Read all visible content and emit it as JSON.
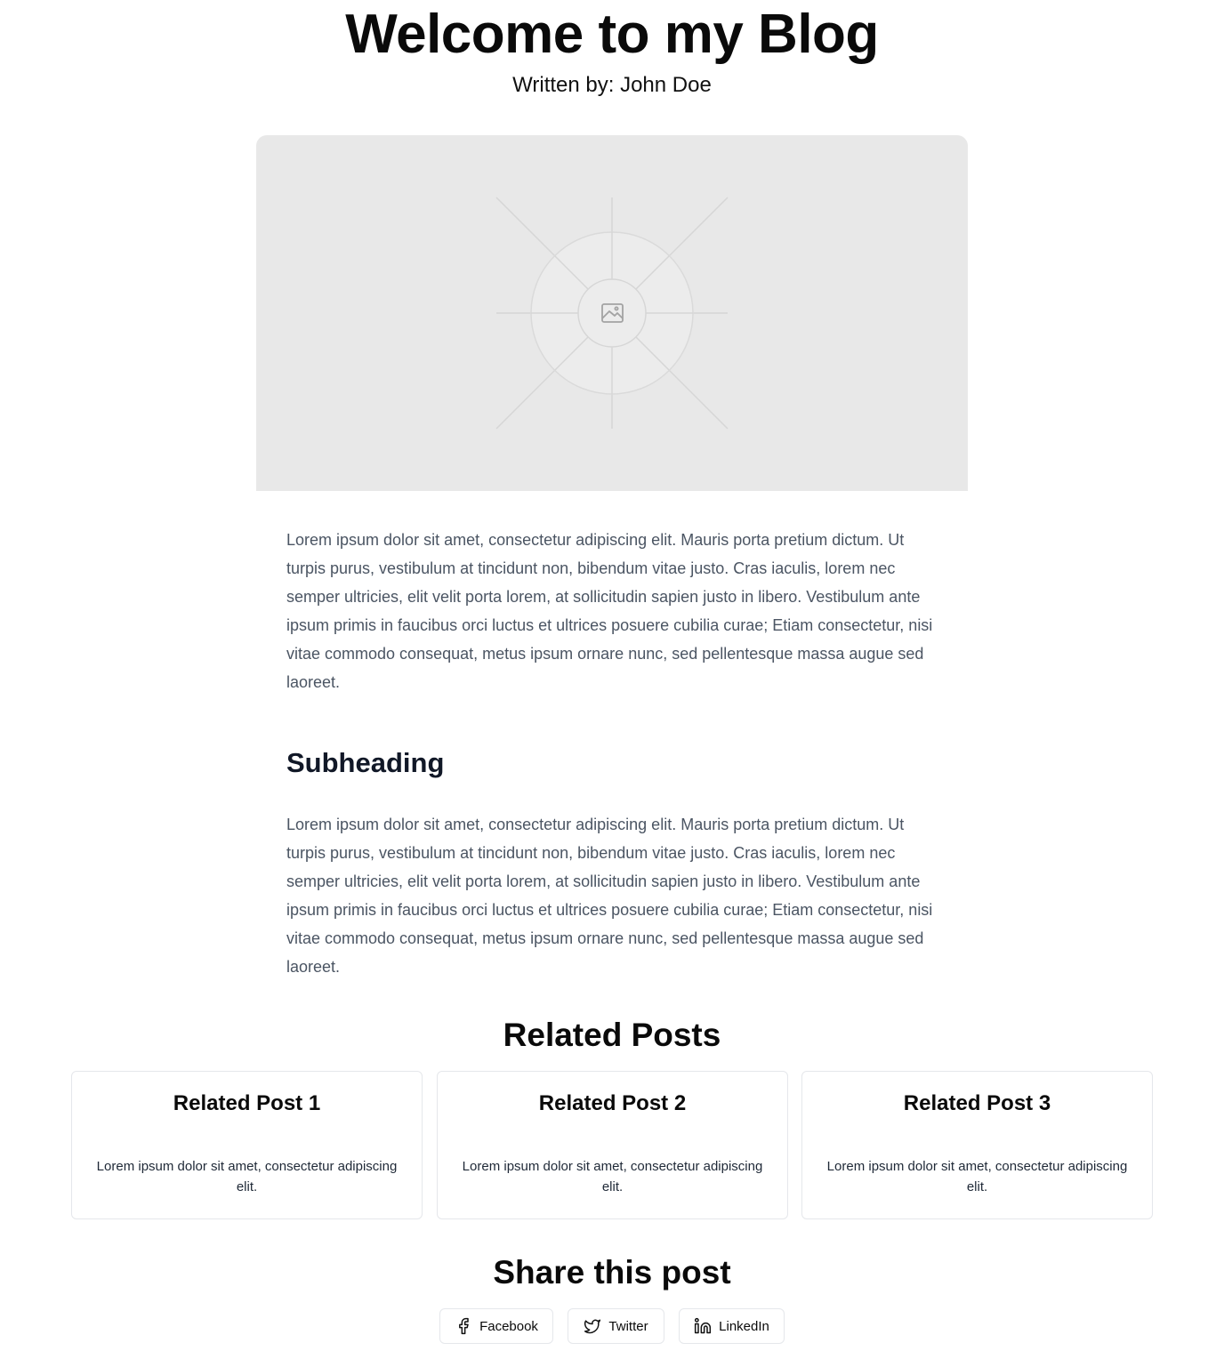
{
  "header": {
    "title": "Welcome to my Blog",
    "byline": "Written by: John Doe"
  },
  "hero": {
    "icon": "image-icon",
    "background": "#e8e8e8"
  },
  "article": {
    "paragraph_1": "Lorem ipsum dolor sit amet, consectetur adipiscing elit. Mauris porta pretium dictum. Ut turpis purus, vestibulum at tincidunt non, bibendum vitae justo. Cras iaculis, lorem nec semper ultricies, elit velit porta lorem, at sollicitudin sapien justo in libero. Vestibulum ante ipsum primis in faucibus orci luctus et ultrices posuere cubilia curae; Etiam consectetur, nisi vitae commodo consequat, metus ipsum ornare nunc, sed pellentesque massa augue sed laoreet.",
    "subheading": "Subheading",
    "paragraph_2": "Lorem ipsum dolor sit amet, consectetur adipiscing elit. Mauris porta pretium dictum. Ut turpis purus, vestibulum at tincidunt non, bibendum vitae justo. Cras iaculis, lorem nec semper ultricies, elit velit porta lorem, at sollicitudin sapien justo in libero. Vestibulum ante ipsum primis in faucibus orci luctus et ultrices posuere cubilia curae; Etiam consectetur, nisi vitae commodo consequat, metus ipsum ornare nunc, sed pellentesque massa augue sed laoreet."
  },
  "related": {
    "title": "Related Posts",
    "posts": [
      {
        "title": "Related Post 1",
        "excerpt": "Lorem ipsum dolor sit amet, consectetur adipiscing elit."
      },
      {
        "title": "Related Post 2",
        "excerpt": "Lorem ipsum dolor sit amet, consectetur adipiscing elit."
      },
      {
        "title": "Related Post 3",
        "excerpt": "Lorem ipsum dolor sit amet, consectetur adipiscing elit."
      }
    ]
  },
  "share": {
    "title": "Share this post",
    "buttons": [
      {
        "label": "Facebook",
        "icon": "facebook-icon"
      },
      {
        "label": "Twitter",
        "icon": "twitter-icon"
      },
      {
        "label": "LinkedIn",
        "icon": "linkedin-icon"
      }
    ]
  },
  "colors": {
    "text": "#0a0a0a",
    "body_text": "#4b5563",
    "border": "#e5e7eb"
  }
}
